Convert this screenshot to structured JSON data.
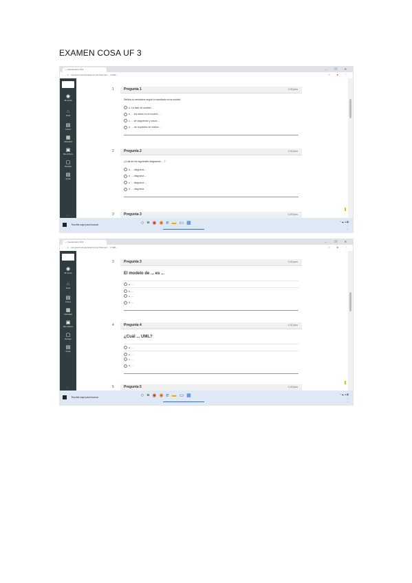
{
  "document": {
    "title": "EXAMEN COSA UF 3"
  },
  "browser": {
    "tab_title": "— Cuestionario UF3 ...",
    "url": "← → C  ...campus/mod/quiz/attempt.php?attempt=... 2 FEB ...",
    "window_controls": "– ❐ ✕"
  },
  "sidebar": {
    "items": [
      {
        "label": "Mi cuenta",
        "icon": "user-icon"
      },
      {
        "label": "Panel",
        "icon": "dashboard-icon"
      },
      {
        "label": "Cursos",
        "icon": "courses-icon"
      },
      {
        "label": "Calendario",
        "icon": "calendar-icon"
      },
      {
        "label": "Mis archivos",
        "icon": "files-icon"
      },
      {
        "label": "Bandeja",
        "icon": "inbox-icon"
      },
      {
        "label": "Ayuda",
        "icon": "help-icon"
      }
    ]
  },
  "screenshot1": {
    "questions": [
      {
        "number": "1",
        "title": "Pregunta 1",
        "points": "1,00 ptos",
        "text": "Señala la verdadera según lo estudiado en la unidad:",
        "options": [
          "a. La fase de análisis ...",
          "b. ... los datos en el modelo ...",
          "c. ... de diagramas y casos ...",
          "d. ... de requisitos se realiza ..."
        ]
      },
      {
        "number": "2",
        "title": "Pregunta 2",
        "points": "1,00 ptos",
        "text": "¿Cuál de los siguientes diagramas ... ?",
        "options": [
          "a. ... diagrama ...",
          "b. ... diagrama ...",
          "c. ... diagrama ...",
          "d. ... diagrama"
        ]
      },
      {
        "number": "3",
        "title": "Pregunta 3",
        "points": "1,00 ptos",
        "text": "",
        "options": []
      }
    ]
  },
  "screenshot2": {
    "questions": [
      {
        "number": "3",
        "title": "Pregunta 3",
        "points": "1,00 ptos",
        "text": "El modelo de ... es ...",
        "options": [
          "a. ...",
          "b. ...",
          "c. ...",
          "d. ..."
        ]
      },
      {
        "number": "4",
        "title": "Pregunta 4",
        "points": "1,00 ptos",
        "text": "¿Cuál ... UML?",
        "options": [
          "a. ...",
          "b. ...",
          "c. ...",
          "d. ..."
        ]
      },
      {
        "number": "5",
        "title": "Pregunta 5",
        "points": "1,00 ptos",
        "text": "",
        "options": []
      }
    ]
  },
  "taskbar": {
    "search_placeholder": "Escribe aquí para buscar",
    "clock_time": "...",
    "clock_date": "..."
  },
  "colors": {
    "sidebar": "#2f3d40",
    "taskbar": "#dfe9f5",
    "accent": "#2a72c8"
  }
}
